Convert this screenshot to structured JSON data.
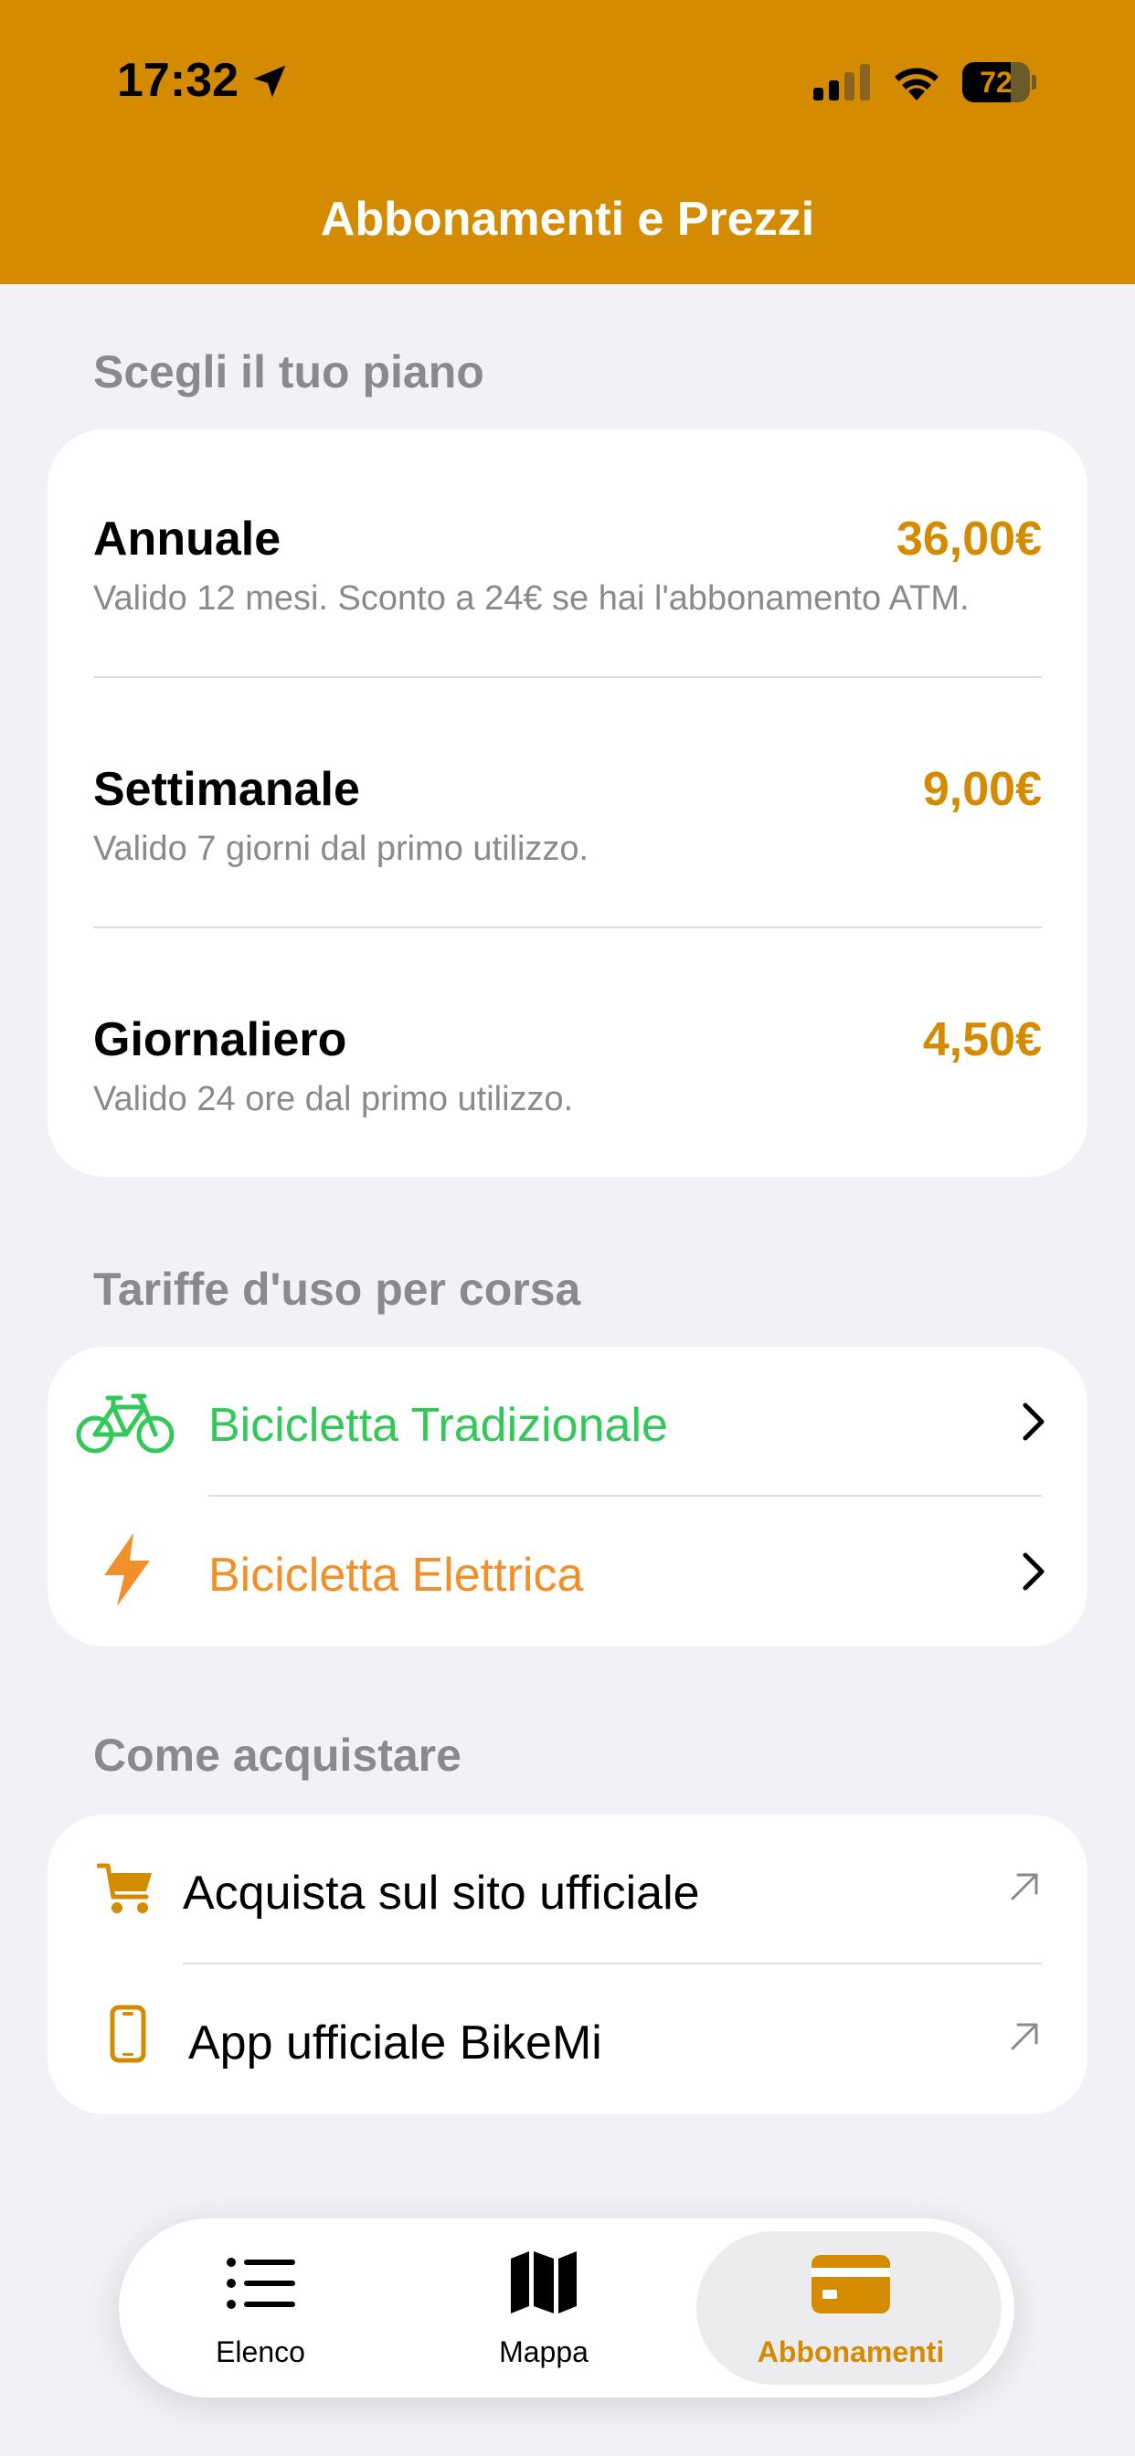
{
  "status_bar": {
    "time": "17:32",
    "battery": "72",
    "battery_level": 0.72
  },
  "nav": {
    "title": "Abbonamenti e Prezzi"
  },
  "plans_section": {
    "title": "Scegli il tuo piano",
    "plans": [
      {
        "name": "Annuale",
        "price": "36,00€",
        "description": "Valido 12 mesi. Sconto a 24€ se hai l'abbonamento ATM."
      },
      {
        "name": "Settimanale",
        "price": "9,00€",
        "description": "Valido 7 giorni dal primo utilizzo."
      },
      {
        "name": "Giornaliero",
        "price": "4,50€",
        "description": "Valido 24 ore dal primo utilizzo."
      }
    ]
  },
  "fares_section": {
    "title": "Tariffe d'uso per corsa",
    "items": [
      {
        "label": "Bicicletta Tradizionale",
        "icon": "bicycle-icon",
        "color": "#34c759"
      },
      {
        "label": "Bicicletta Elettrica",
        "icon": "bolt-icon",
        "color": "#f0902a"
      }
    ]
  },
  "purchase_section": {
    "title": "Come acquistare",
    "items": [
      {
        "label": "Acquista sul sito ufficiale",
        "icon": "cart-icon"
      },
      {
        "label": "App ufficiale BikeMi",
        "icon": "phone-icon"
      }
    ]
  },
  "tabbar": {
    "tabs": [
      {
        "label": "Elenco",
        "icon": "list-icon",
        "active": false
      },
      {
        "label": "Mappa",
        "icon": "map-icon",
        "active": false
      },
      {
        "label": "Abbonamenti",
        "icon": "card-icon",
        "active": true
      }
    ]
  },
  "colors": {
    "accent": "#d48b00",
    "background": "#f2f1f6",
    "secondary_text": "#8a8a8e"
  }
}
